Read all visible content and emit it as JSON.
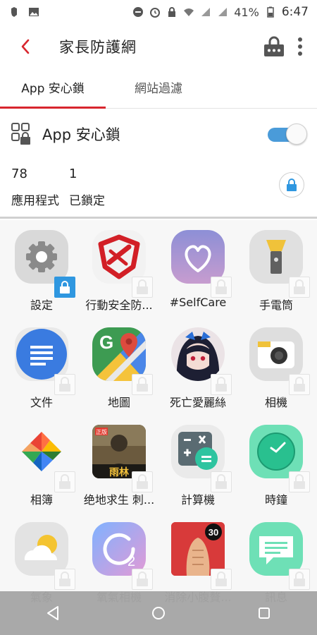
{
  "status_bar": {
    "battery_percent": "41%",
    "time": "6:47",
    "icons": [
      "evernote-icon",
      "image-icon",
      "do-not-disturb-icon",
      "alarm-icon",
      "lock-icon",
      "wifi-icon",
      "signal-icon",
      "signal-icon",
      "battery-icon"
    ]
  },
  "app_bar": {
    "title": "家長防護網",
    "icons": [
      "back-arrow-icon",
      "pin-lock-icon",
      "more-vert-icon"
    ]
  },
  "tabs": [
    {
      "label": "App 安心鎖",
      "active": true
    },
    {
      "label": "網站過濾",
      "active": false
    }
  ],
  "app_lock": {
    "label": "App 安心鎖",
    "enabled": true,
    "apps_count": "78",
    "apps_label": "應用程式",
    "locked_count": "1",
    "locked_label": "已鎖定"
  },
  "apps": [
    {
      "name": "設定",
      "icon": "settings-gear-icon",
      "locked": true
    },
    {
      "name": "行動安全防...",
      "icon": "mobile-security-icon",
      "locked": false
    },
    {
      "name": "#SelfCare",
      "icon": "heart-icon",
      "locked": false
    },
    {
      "name": "手電筒",
      "icon": "flashlight-icon",
      "locked": false
    },
    {
      "name": "文件",
      "icon": "docs-icon",
      "locked": false
    },
    {
      "name": "地圖",
      "icon": "maps-icon",
      "locked": false
    },
    {
      "name": "死亡愛麗絲",
      "icon": "anime-girl-icon",
      "locked": false
    },
    {
      "name": "相機",
      "icon": "camera-icon",
      "locked": false
    },
    {
      "name": "相簿",
      "icon": "photos-pinwheel-icon",
      "locked": false
    },
    {
      "name": "绝地求生 刺...",
      "icon": "game-soldier-icon",
      "locked": false
    },
    {
      "name": "計算機",
      "icon": "calculator-icon",
      "locked": false
    },
    {
      "name": "時鐘",
      "icon": "clock-icon",
      "locked": false
    },
    {
      "name": "氣象",
      "icon": "weather-icon",
      "locked": false
    },
    {
      "name": "氧氣相機",
      "icon": "oxygen-camera-icon",
      "locked": false
    },
    {
      "name": "消除小腹贅...",
      "icon": "fitness-30-icon",
      "locked": false
    },
    {
      "name": "訊息",
      "icon": "messages-icon",
      "locked": false
    }
  ],
  "icon_text": {
    "game_label": "雨林",
    "game_tag": "正版",
    "fitness_badge": "30",
    "oxygen_badge": "2"
  },
  "colors": {
    "accent_red": "#d8262e",
    "toggle_blue": "#4a9bd9",
    "lock_blue": "#2f97e0",
    "navbar_gray": "#a5a5a5"
  },
  "nav_bar": {
    "icons": [
      "back-triangle-icon",
      "home-circle-icon",
      "recents-square-icon"
    ]
  }
}
